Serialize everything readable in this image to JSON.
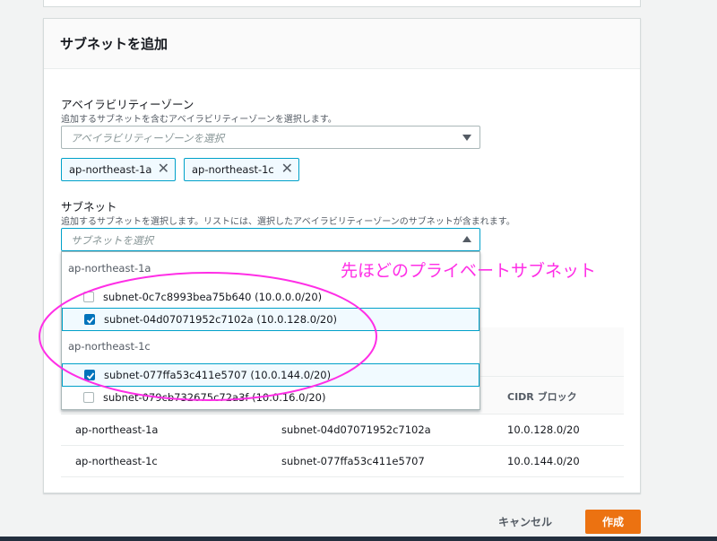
{
  "panel": {
    "title": "サブネットを追加"
  },
  "az_field": {
    "label": "アベイラビリティーゾーン",
    "description": "追加するサブネットを含むアベイラビリティーゾーンを選択します。",
    "placeholder": "アベイラビリティーゾーンを選択",
    "tokens": [
      "ap-northeast-1a",
      "ap-northeast-1c"
    ]
  },
  "subnet_field": {
    "label": "サブネット",
    "description": "追加するサブネットを選択します。リストには、選択したアベイラビリティーゾーンのサブネットが含まれます。",
    "placeholder": "サブネットを選択",
    "groups": [
      {
        "name": "ap-northeast-1a",
        "options": [
          {
            "label": "subnet-0c7c8993bea75b640 (10.0.0.0/20)",
            "checked": false
          },
          {
            "label": "subnet-04d07071952c7102a (10.0.128.0/20)",
            "checked": true
          }
        ]
      },
      {
        "name": "ap-northeast-1c",
        "options": [
          {
            "label": "subnet-077ffa53c411e5707 (10.0.144.0/20)",
            "checked": true
          },
          {
            "label": "subnet-079cb732675c72a3f (10.0.16.0/20)",
            "checked": false
          }
        ]
      }
    ]
  },
  "table": {
    "header_cidr": "CIDR ブロック",
    "rows": [
      {
        "az": "ap-northeast-1a",
        "subnet": "subnet-04d07071952c7102a",
        "cidr": "10.0.128.0/20"
      },
      {
        "az": "ap-northeast-1c",
        "subnet": "subnet-077ffa53c411e5707",
        "cidr": "10.0.144.0/20"
      }
    ]
  },
  "annotation": {
    "text": "先ほどのプライベートサブネット",
    "color": "#ff2ee6"
  },
  "footer": {
    "cancel_label": "キャンセル",
    "create_label": "作成"
  },
  "colors": {
    "accent": "#00a1c9",
    "primary_button": "#ec7211",
    "checkbox": "#0073bb"
  }
}
